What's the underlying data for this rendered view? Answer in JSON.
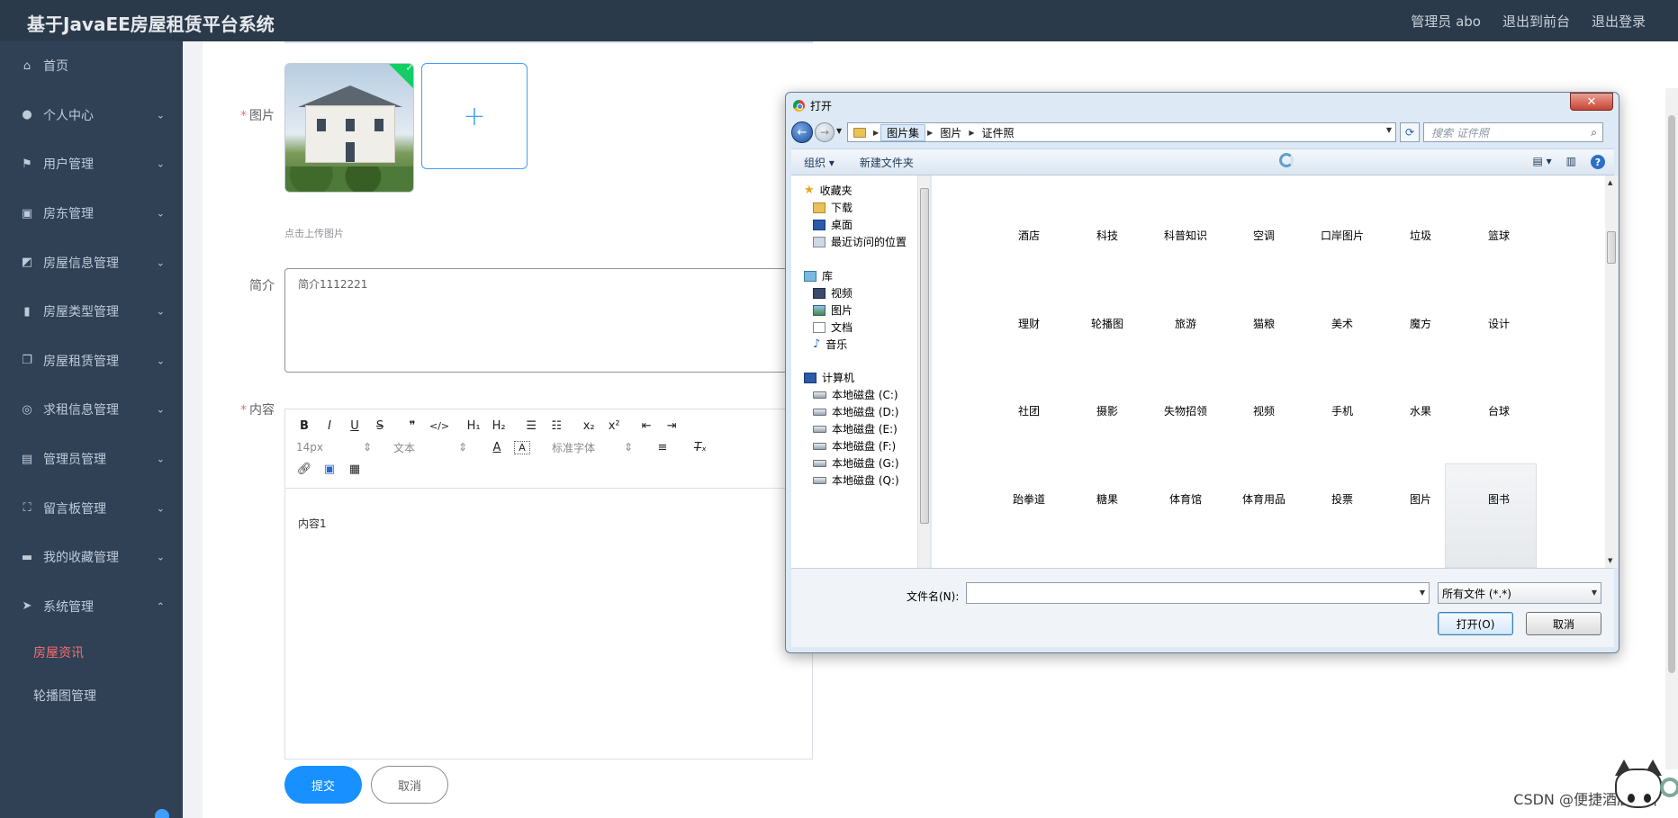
{
  "header": {
    "title": "基于JavaEE房屋租赁平台系统",
    "admin_label": "管理员 abo",
    "to_front": "退出到前台",
    "logout": "退出登录"
  },
  "sidebar": {
    "items": [
      {
        "label": "首页",
        "icon": "home-icon"
      },
      {
        "label": "个人中心",
        "icon": "user-icon"
      },
      {
        "label": "用户管理",
        "icon": "flag-icon"
      },
      {
        "label": "房东管理",
        "icon": "clipboard-check-icon"
      },
      {
        "label": "房屋信息管理",
        "icon": "chart-area-icon"
      },
      {
        "label": "房屋类型管理",
        "icon": "bar-chart-icon"
      },
      {
        "label": "房屋租赁管理",
        "icon": "copy-icon"
      },
      {
        "label": "求租信息管理",
        "icon": "lifebuoy-icon"
      },
      {
        "label": "管理员管理",
        "icon": "clipboard-icon"
      },
      {
        "label": "留言板管理",
        "icon": "expand-icon"
      },
      {
        "label": "我的收藏管理",
        "icon": "comment-icon"
      },
      {
        "label": "系统管理",
        "icon": "send-icon"
      }
    ],
    "sub_items": [
      {
        "label": "房屋资讯",
        "active": true
      },
      {
        "label": "轮播图管理",
        "active": false
      }
    ]
  },
  "form": {
    "image_label": "图片",
    "upload_hint": "点击上传图片",
    "intro_label": "简介",
    "intro_value": "简介1112221",
    "content_label": "内容",
    "content_value": "内容1",
    "submit": "提交",
    "cancel": "取消",
    "editor": {
      "font_size": "14px",
      "block_type": "文本",
      "font_family": "标准字体"
    }
  },
  "dialog": {
    "title": "打开",
    "breadcrumb": [
      "图片集",
      "图片",
      "证件照"
    ],
    "search_placeholder": "搜索 证件照",
    "organize": "组织 ▾",
    "new_folder": "新建文件夹",
    "nav": {
      "favorites": "收藏夹",
      "downloads": "下载",
      "desktop": "桌面",
      "recent": "最近访问的位置",
      "library": "库",
      "videos": "视频",
      "pictures": "图片",
      "documents": "文档",
      "music": "音乐",
      "computer": "计算机",
      "disks": [
        "本地磁盘 (C:)",
        "本地磁盘 (D:)",
        "本地磁盘 (E:)",
        "本地磁盘 (F:)",
        "本地磁盘 (G:)",
        "本地磁盘 (Q:)"
      ]
    },
    "files": [
      [
        "酒店",
        "科技",
        "科普知识",
        "空调",
        "口岸图片",
        "垃圾",
        "篮球"
      ],
      [
        "理财",
        "轮播图",
        "旅游",
        "猫粮",
        "美术",
        "魔方",
        "设计"
      ],
      [
        "社团",
        "摄影",
        "失物招领",
        "视频",
        "手机",
        "水果",
        "台球"
      ],
      [
        "跆拳道",
        "糖果",
        "体育馆",
        "体育用品",
        "投票",
        "图片",
        "图书"
      ]
    ],
    "filename_label": "文件名(N):",
    "filename_value": "",
    "filetype": "所有文件 (*.*)",
    "open_btn": "打开(O)",
    "cancel_btn": "取消"
  },
  "watermark": "CSDN @便捷酒店设计"
}
